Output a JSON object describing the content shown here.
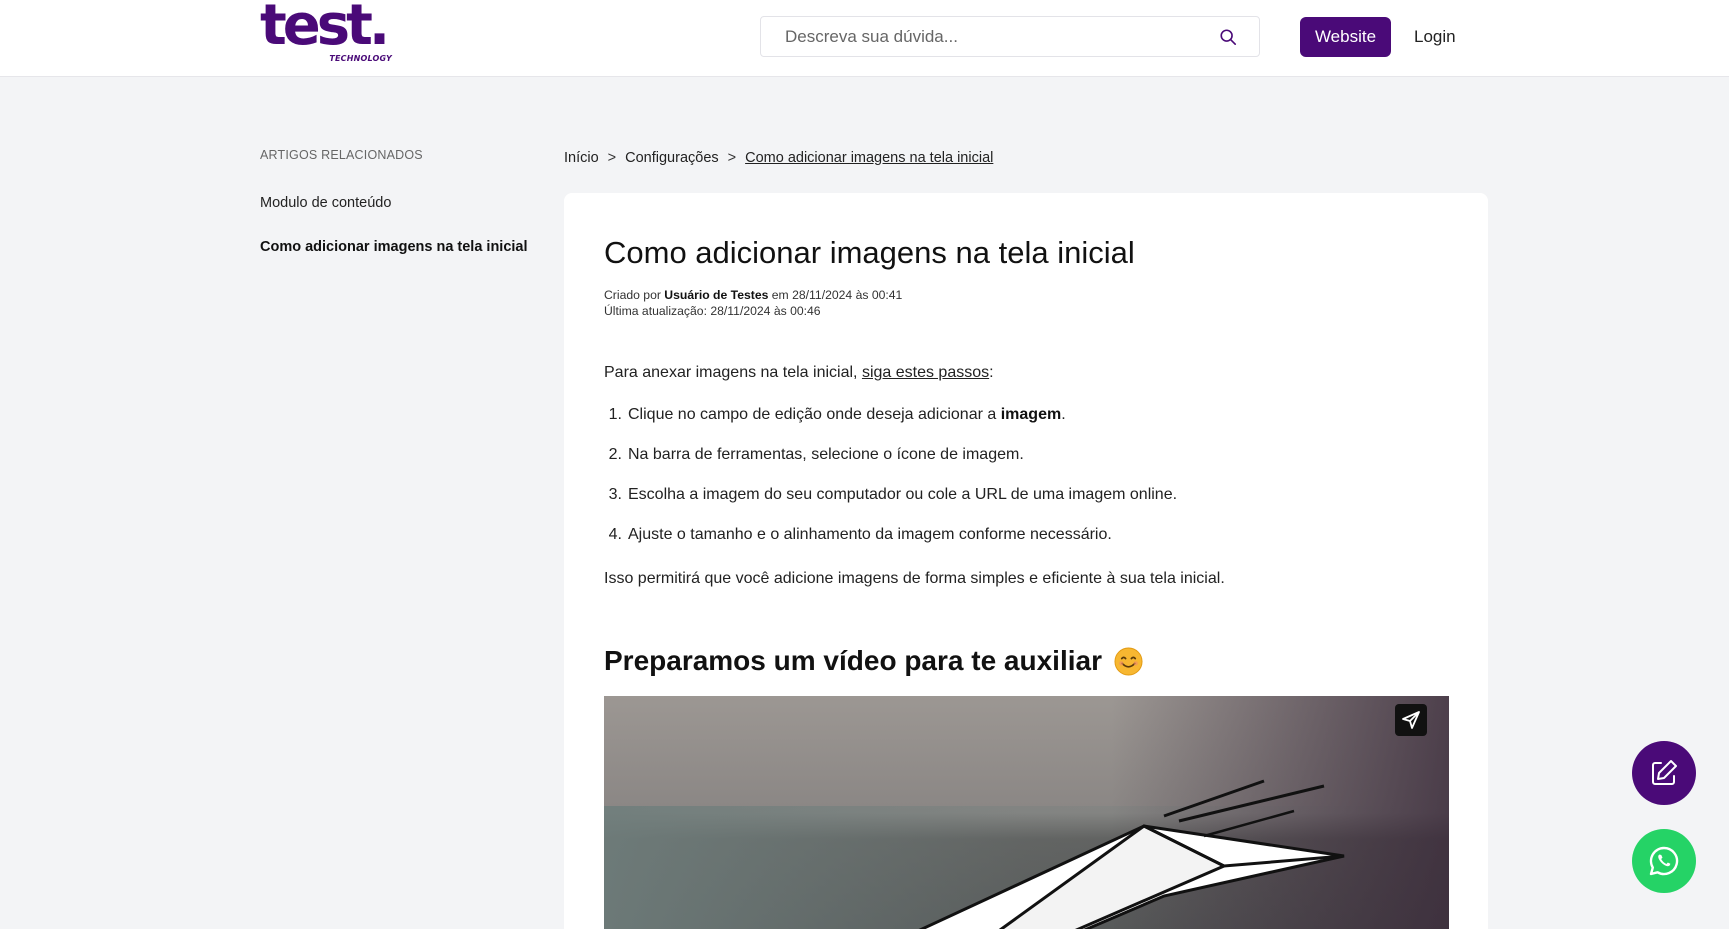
{
  "header": {
    "logo_text": "test.",
    "logo_subtext": "TECHNOLOGY",
    "search_placeholder": "Descreva sua dúvida...",
    "website_button": "Website",
    "login_link": "Login"
  },
  "sidebar": {
    "title": "ARTIGOS RELACIONADOS",
    "items": [
      {
        "label": "Modulo de conteúdo",
        "active": false
      },
      {
        "label": "Como adicionar imagens na tela inicial",
        "active": true
      }
    ]
  },
  "breadcrumb": {
    "items": [
      "Início",
      "Configurações",
      "Como adicionar imagens na tela inicial"
    ],
    "separator": ">"
  },
  "article": {
    "title": "Como adicionar imagens na tela inicial",
    "created_prefix": "Criado por",
    "author": "Usuário de Testes",
    "created_suffix": "em 28/11/2024 às 00:41",
    "updated": "Última atualização: 28/11/2024 às 00:46",
    "intro_text": "Para anexar imagens na tela inicial,",
    "intro_link": "siga estes passos",
    "intro_end": ":",
    "steps": [
      {
        "num": "1.",
        "text": "Clique no campo de edição onde deseja adicionar a",
        "bold": "imagem",
        "end": "."
      },
      {
        "num": "2.",
        "text": "Na barra de ferramentas, selecione o ícone de imagem.",
        "bold": "",
        "end": ""
      },
      {
        "num": "3.",
        "text": "Escolha a imagem do seu computador ou cole a URL de uma imagem online.",
        "bold": "",
        "end": ""
      },
      {
        "num": "4.",
        "text": "Ajuste o tamanho e o alinhamento da imagem conforme necessário.",
        "bold": "",
        "end": ""
      }
    ],
    "outro": "Isso permitirá que você adicione imagens de forma simples e eficiente à sua tela inicial.",
    "video_heading": "Preparamos um vídeo para te auxiliar"
  },
  "icons": {
    "search": "search-icon",
    "share": "share-icon",
    "emoji": "smiling-face-icon",
    "edit": "edit-icon",
    "whatsapp": "whatsapp-icon"
  },
  "colors": {
    "brand_purple": "#4a0a78",
    "whatsapp_green": "#25d366",
    "page_bg": "#f3f4f6"
  }
}
